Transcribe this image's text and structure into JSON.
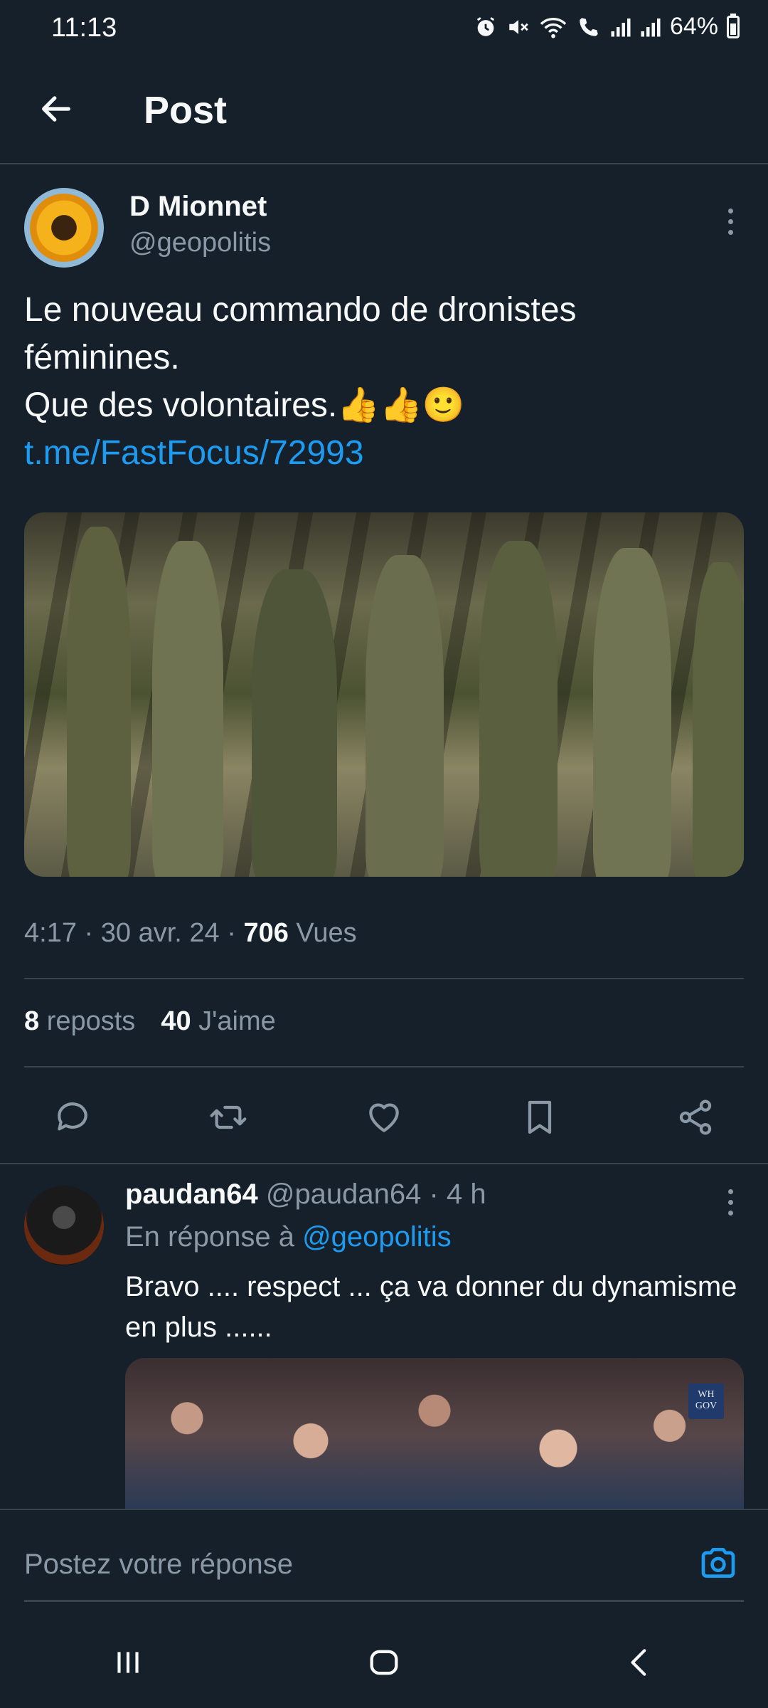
{
  "status_bar": {
    "time": "11:13",
    "battery": "64%",
    "icons": [
      "alarm-icon",
      "mute-icon",
      "wifi-icon",
      "wifi-call-icon",
      "signal-icon",
      "signal-icon",
      "battery-icon"
    ]
  },
  "header": {
    "title": "Post",
    "back_icon": "arrow-left-icon"
  },
  "post": {
    "author_name": "D Mionnet",
    "author_handle": "@geopolitis",
    "text_line1": "Le nouveau commando de dronistes",
    "text_line2": "féminines.",
    "text_line3": "Que des volontaires.👍👍🙂",
    "link": "t.me/FastFocus/72993",
    "time": "4:17",
    "sep1": " · ",
    "date": "30 avr. 24",
    "sep2": " · ",
    "views_count": "706",
    "views_label": " Vues",
    "reposts_count": "8",
    "reposts_label": " reposts",
    "likes_count": "40",
    "likes_label": " J'aime"
  },
  "actions": [
    "reply-icon",
    "repost-icon",
    "like-icon",
    "bookmark-icon",
    "share-icon"
  ],
  "reply": {
    "name": "paudan64",
    "handle": " @paudan64",
    "time": " · 4 h",
    "in_reply_prefix": "En réponse à ",
    "in_reply_mention": "@geopolitis",
    "text": "Bravo .... respect ... ça va donner du dynamisme en plus ......",
    "image_badge": "WH GOV"
  },
  "composer": {
    "placeholder": "Postez votre réponse",
    "camera_icon": "camera-icon"
  },
  "navbar": [
    "recents-icon",
    "home-icon",
    "back-icon"
  ],
  "colors": {
    "background": "#15202b",
    "accent": "#1d9bf0",
    "text_primary": "#f7f9f9",
    "text_secondary": "#8b98a5",
    "divider": "#38444d"
  }
}
